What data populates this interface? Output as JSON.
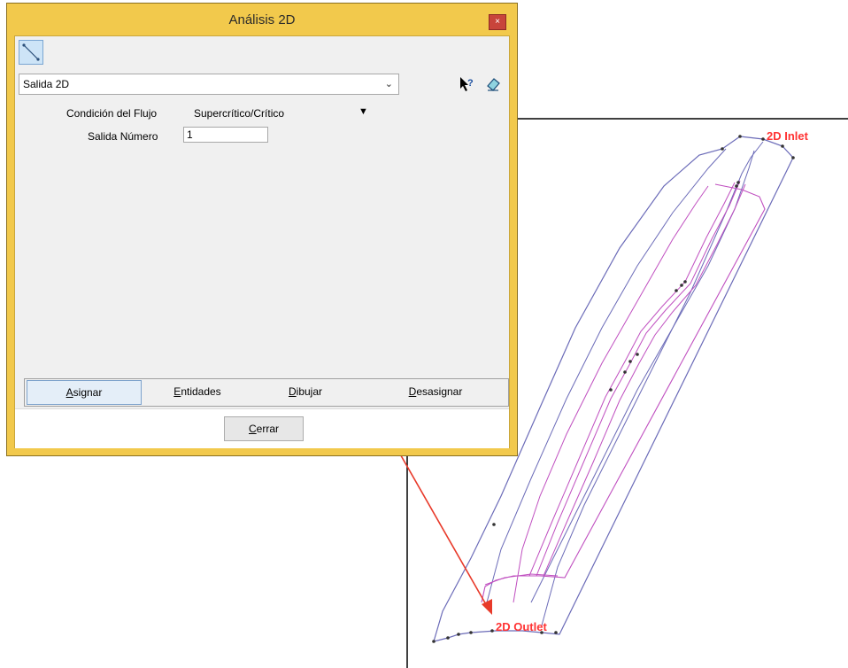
{
  "window": {
    "title": "Análisis 2D",
    "close_glyph": "×"
  },
  "toolbar": {
    "tool_icon": "line-tool-icon"
  },
  "selector": {
    "value": "Salida 2D",
    "arrow": "⌄",
    "help_icon": "context-help-icon",
    "eraser_icon": "eraser-icon"
  },
  "form": {
    "flow_condition_label": "Condición del Flujo",
    "flow_condition_value": "Supercrítico/Crítico",
    "dropdown_arrow": "▼",
    "outlet_number_label": "Salida Número",
    "outlet_number_value": "1"
  },
  "buttons": {
    "asignar": {
      "first": "A",
      "rest": "signar"
    },
    "entidades": {
      "first": "E",
      "rest": "ntidades"
    },
    "dibujar": {
      "first": "D",
      "rest": "ibujar"
    },
    "desasignar": {
      "first": "D",
      "rest": "esasignar"
    },
    "cerrar": {
      "first": "C",
      "rest": "errar"
    }
  },
  "canvas": {
    "inlet_label": "2D Inlet",
    "outlet_label": "2D Outlet",
    "label_color": "#ff3333",
    "boundary_color": "#6b6bb8",
    "channel_color": "#c050c0",
    "arrow_color": "#e83a2a"
  }
}
